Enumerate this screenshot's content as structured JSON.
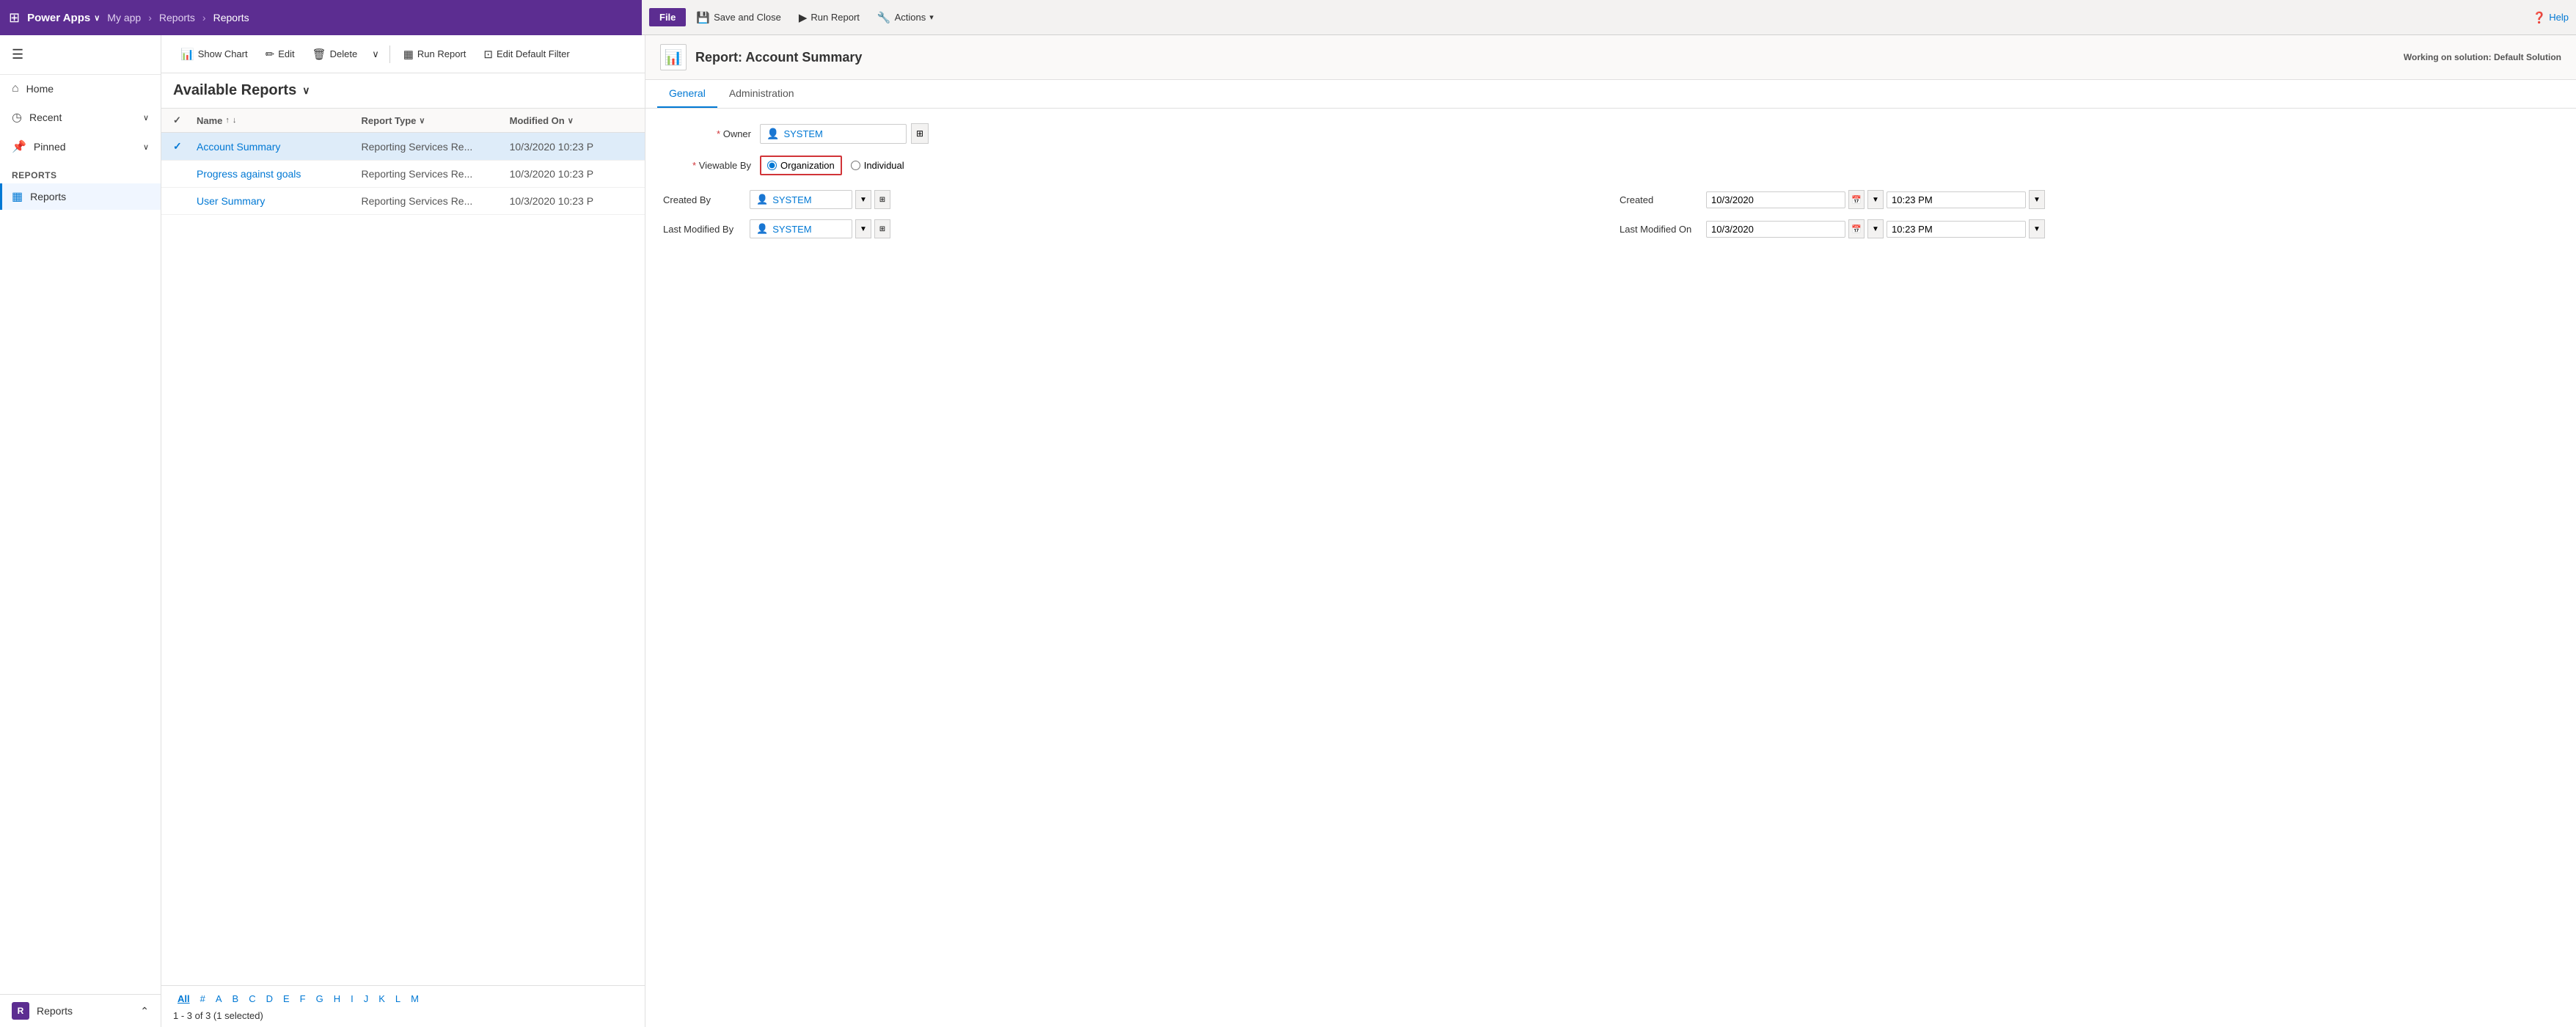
{
  "topNav": {
    "waffle": "⊞",
    "appName": "Power Apps",
    "chevron": "∨",
    "myApp": "My app",
    "breadcrumb1": "Reports",
    "sep": "›",
    "breadcrumb2": "Reports"
  },
  "ribbon": {
    "fileLabel": "File",
    "saveAndClose": "Save and Close",
    "runReport": "Run Report",
    "actions": "Actions",
    "actionsChevron": "▾",
    "help": "Help"
  },
  "sidebar": {
    "collapseIcon": "☰",
    "navItems": [
      {
        "id": "home",
        "icon": "⌂",
        "label": "Home",
        "hasChevron": false
      },
      {
        "id": "recent",
        "icon": "◷",
        "label": "Recent",
        "hasChevron": true
      },
      {
        "id": "pinned",
        "icon": "📌",
        "label": "Pinned",
        "hasChevron": true
      }
    ],
    "sectionLabel": "Reports",
    "linkItems": [
      {
        "id": "reports",
        "icon": "▦",
        "label": "Reports",
        "active": true
      }
    ],
    "bottomItem": {
      "avatarLetter": "R",
      "label": "Reports",
      "chevron": "⌃"
    }
  },
  "listPane": {
    "toolbar": {
      "showChart": "Show Chart",
      "showChartIcon": "📊",
      "edit": "Edit",
      "editIcon": "✏",
      "delete": "Delete",
      "deleteIcon": "🗑",
      "moreIcon": "∨",
      "runReport": "Run Report",
      "runReportIcon": "▦",
      "editDefaultFilter": "Edit Default Filter",
      "editDefaultFilterIcon": "⊡"
    },
    "listTitle": "Available Reports",
    "listTitleChevron": "∨",
    "tableHeader": {
      "check": "✓",
      "name": "Name",
      "nameSortUp": "↑",
      "nameSortDown": "↓",
      "reportType": "Report Type",
      "reportTypeChevron": "∨",
      "modifiedOn": "Modified On",
      "modifiedOnChevron": "∨"
    },
    "rows": [
      {
        "id": "account-summary",
        "selected": true,
        "check": "✓",
        "name": "Account Summary",
        "reportType": "Reporting Services Re...",
        "modifiedOn": "10/3/2020 10:23 P"
      },
      {
        "id": "progress-goals",
        "selected": false,
        "check": "",
        "name": "Progress against goals",
        "reportType": "Reporting Services Re...",
        "modifiedOn": "10/3/2020 10:23 P"
      },
      {
        "id": "user-summary",
        "selected": false,
        "check": "",
        "name": "User Summary",
        "reportType": "Reporting Services Re...",
        "modifiedOn": "10/3/2020 10:23 P"
      }
    ],
    "pagination": {
      "letters": [
        "All",
        "#",
        "A",
        "B",
        "C",
        "D",
        "E",
        "F",
        "G",
        "H",
        "I",
        "J",
        "K",
        "L",
        "M"
      ],
      "activeLetter": "All",
      "count": "1 - 3 of 3 (1 selected)"
    }
  },
  "detailPane": {
    "iconSymbol": "📊",
    "title": "Report: Account Summary",
    "workingOn": "Working on solution: Default Solution",
    "tabs": [
      {
        "id": "general",
        "label": "General",
        "active": true
      },
      {
        "id": "administration",
        "label": "Administration",
        "active": false
      }
    ],
    "form": {
      "ownerLabel": "Owner",
      "ownerValue": "SYSTEM",
      "viewableByLabel": "Viewable By",
      "organizationLabel": "Organization",
      "individualLabel": "Individual",
      "createdByLabel": "Created By",
      "createdByValue": "SYSTEM",
      "createdOnLabel": "Created",
      "createdOnDate": "10/3/2020",
      "createdOnTime": "10:23 PM",
      "lastModifiedByLabel": "Last Modified By",
      "lastModifiedByValue": "SYSTEM",
      "lastModifiedOnLabel": "Last Modified On",
      "lastModifiedOnDate": "10/3/2020",
      "lastModifiedOnTime": "10:23 PM"
    }
  }
}
